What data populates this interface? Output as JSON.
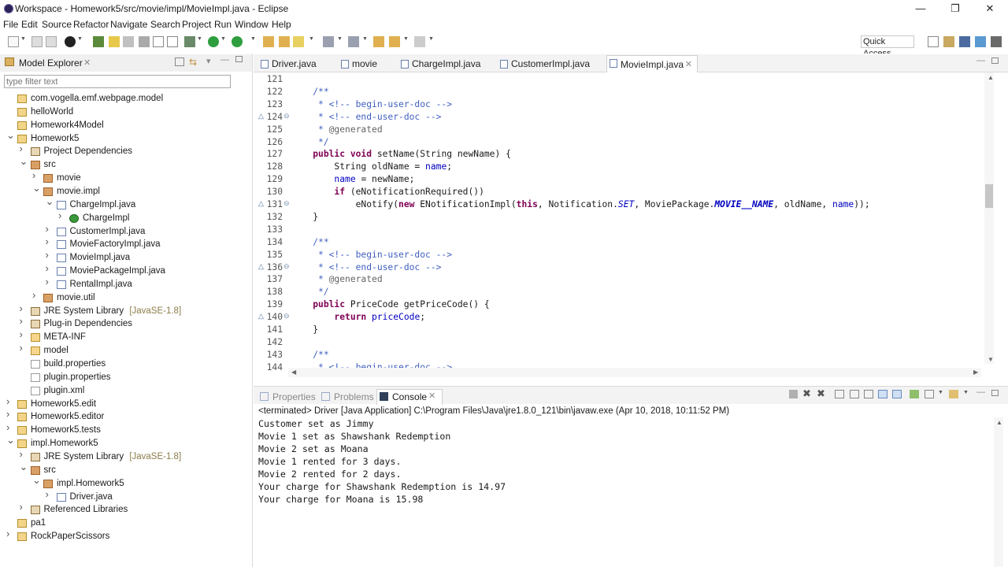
{
  "window": {
    "title": "Workspace - Homework5/src/movie/impl/MovieImpl.java - Eclipse",
    "minimize": "—",
    "maximize": "❐",
    "close": "✕"
  },
  "menu": [
    "File",
    "Edit",
    "Source",
    "Refactor",
    "Navigate",
    "Search",
    "Project",
    "Run",
    "Window",
    "Help"
  ],
  "toolbar": {
    "quick_access": "Quick Access"
  },
  "explorer": {
    "title": "Model Explorer",
    "filter_placeholder": "type filter text",
    "tree": [
      {
        "label": "com.vogella.emf.webpage.model",
        "icon": "project-icon"
      },
      {
        "label": "helloWorld",
        "icon": "project-icon"
      },
      {
        "label": "Homework4Model",
        "icon": "project-icon"
      },
      {
        "label": "Homework5",
        "icon": "project-icon",
        "arrow": "v"
      },
      {
        "label": "Project Dependencies",
        "icon": "library-icon",
        "arrow": ">"
      },
      {
        "label": "src",
        "icon": "source-folder-icon",
        "arrow": "v"
      },
      {
        "label": "movie",
        "icon": "package-icon",
        "arrow": ">"
      },
      {
        "label": "movie.impl",
        "icon": "package-icon",
        "arrow": "v"
      },
      {
        "label": "ChargeImpl.java",
        "icon": "java-file-icon",
        "arrow": "v"
      },
      {
        "label": "ChargeImpl",
        "icon": "class-icon",
        "arrow": ">"
      },
      {
        "label": "CustomerImpl.java",
        "icon": "java-file-icon",
        "arrow": ">"
      },
      {
        "label": "MovieFactoryImpl.java",
        "icon": "java-file-icon",
        "arrow": ">"
      },
      {
        "label": "MovieImpl.java",
        "icon": "java-file-icon",
        "arrow": ">"
      },
      {
        "label": "MoviePackageImpl.java",
        "icon": "java-file-icon",
        "arrow": ">"
      },
      {
        "label": "RentalImpl.java",
        "icon": "java-file-icon",
        "arrow": ">"
      },
      {
        "label": "movie.util",
        "icon": "package-icon",
        "arrow": ">"
      },
      {
        "label": "JRE System Library",
        "suffix": "[JavaSE-1.8]",
        "icon": "library-icon",
        "arrow": ">"
      },
      {
        "label": "Plug-in Dependencies",
        "icon": "library-icon",
        "arrow": ">"
      },
      {
        "label": "META-INF",
        "icon": "folder-icon",
        "arrow": ">"
      },
      {
        "label": "model",
        "icon": "folder-icon",
        "arrow": ">"
      },
      {
        "label": "build.properties",
        "icon": "properties-file-icon"
      },
      {
        "label": "plugin.properties",
        "icon": "properties-file-icon"
      },
      {
        "label": "plugin.xml",
        "icon": "xml-file-icon"
      },
      {
        "label": "Homework5.edit",
        "icon": "project-icon",
        "arrow": ">"
      },
      {
        "label": "Homework5.editor",
        "icon": "project-icon",
        "arrow": ">"
      },
      {
        "label": "Homework5.tests",
        "icon": "project-icon",
        "arrow": ">"
      },
      {
        "label": "impl.Homework5",
        "icon": "project-icon",
        "arrow": "v"
      },
      {
        "label": "JRE System Library",
        "suffix": "[JavaSE-1.8]",
        "icon": "library-icon",
        "arrow": ">"
      },
      {
        "label": "src",
        "icon": "source-folder-icon",
        "arrow": "v"
      },
      {
        "label": "impl.Homework5",
        "icon": "package-icon",
        "arrow": "v"
      },
      {
        "label": "Driver.java",
        "icon": "java-file-icon",
        "arrow": ">"
      },
      {
        "label": "Referenced Libraries",
        "icon": "library-icon",
        "arrow": ">"
      },
      {
        "label": "pa1",
        "icon": "project-icon"
      },
      {
        "label": "RockPaperScissors",
        "icon": "project-icon",
        "arrow": ">"
      }
    ]
  },
  "editor": {
    "tabs": [
      "Driver.java",
      "movie",
      "ChargeImpl.java",
      "CustomerImpl.java",
      "MovieImpl.java"
    ],
    "active_tab": "MovieImpl.java",
    "lines": [
      {
        "n": "121",
        "html": ""
      },
      {
        "n": "122",
        "html": "    <span class='cm'>/**</span>"
      },
      {
        "n": "123",
        "html": "<span class='cm'>     * &lt;!-- begin-user-doc --&gt;</span>"
      },
      {
        "n": "124",
        "html": "<span class='cm'>     * &lt;!-- end-user-doc --&gt;</span>",
        "marker": "⊖"
      },
      {
        "n": "125",
        "html": "<span class='cm'>     * </span><span class='an'>@generated</span>"
      },
      {
        "n": "126",
        "html": "<span class='cm'>     */</span>"
      },
      {
        "n": "127",
        "html": "    <span class='kw'>public void</span> setName(String newName) {"
      },
      {
        "n": "128",
        "html": "        String oldName = <span class='fld'>name</span>;"
      },
      {
        "n": "129",
        "html": "        <span class='fld'>name</span> = newName;"
      },
      {
        "n": "130",
        "html": "        <span class='kw'>if</span> (eNotificationRequired())"
      },
      {
        "n": "131",
        "html": "            eNotify(<span class='kw'>new</span> ENotificationImpl(<span class='kw'>this</span>, Notification.<span class='fi'>SET</span>, MoviePackage.<span class='sf'>MOVIE__NAME</span>, oldName, <span class='fld'>name</span>));",
        "marker": "⊖"
      },
      {
        "n": "132",
        "html": "    }"
      },
      {
        "n": "133",
        "html": ""
      },
      {
        "n": "134",
        "html": "    <span class='cm'>/**</span>"
      },
      {
        "n": "135",
        "html": "<span class='cm'>     * &lt;!-- begin-user-doc --&gt;</span>"
      },
      {
        "n": "136",
        "html": "<span class='cm'>     * &lt;!-- end-user-doc --&gt;</span>",
        "marker": "⊖"
      },
      {
        "n": "137",
        "html": "<span class='cm'>     * </span><span class='an'>@generated</span>"
      },
      {
        "n": "138",
        "html": "<span class='cm'>     */</span>"
      },
      {
        "n": "139",
        "html": "    <span class='kw'>public</span> PriceCode getPriceCode() {"
      },
      {
        "n": "140",
        "html": "        <span class='kw'>return</span> <span class='fld'>priceCode</span>;",
        "marker": "⊖"
      },
      {
        "n": "141",
        "html": "    }"
      },
      {
        "n": "142",
        "html": ""
      },
      {
        "n": "143",
        "html": "    <span class='cm'>/**</span>"
      },
      {
        "n": "144",
        "html": "<span class='cm'>     * &lt;!-- begin-user-doc --&gt;</span>"
      }
    ]
  },
  "console_view": {
    "tabs": [
      "Properties",
      "Problems",
      "Console"
    ],
    "active_tab": "Console",
    "status": "<terminated> Driver [Java Application] C:\\Program Files\\Java\\jre1.8.0_121\\bin\\javaw.exe (Apr 10, 2018, 10:11:52 PM)",
    "output": [
      "Customer set as Jimmy",
      "Movie 1 set as Shawshank Redemption",
      "Movie 2 set as Moana",
      "Movie 1 rented for 3 days.",
      "Movie 2 rented for 2 days.",
      "Your charge for Shawshank Redemption is 14.97",
      "Your charge for Moana is 15.98"
    ]
  }
}
